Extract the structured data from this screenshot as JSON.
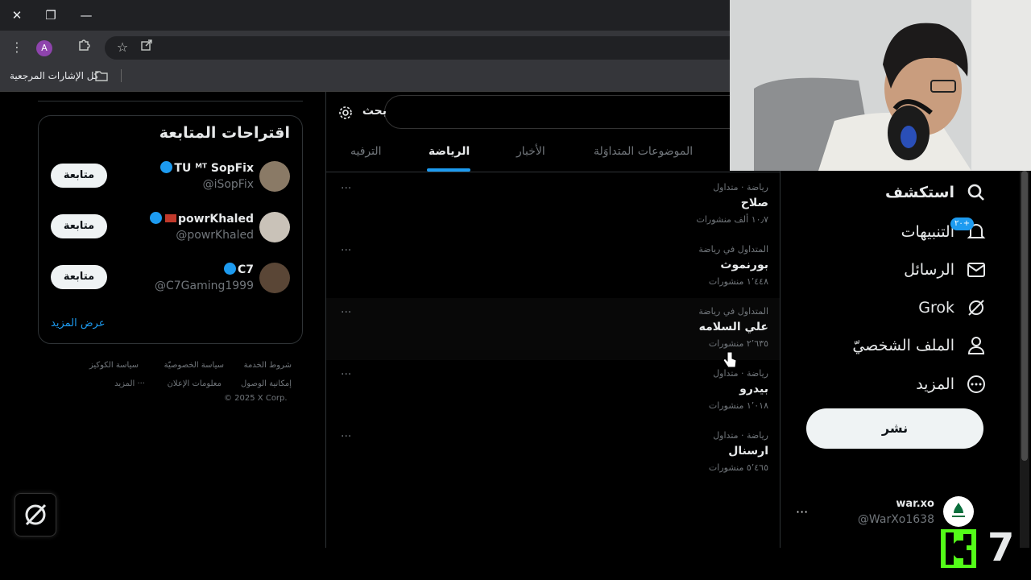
{
  "browser": {
    "avatar_letter": "A",
    "bookmarks_label": "كل الإشارات المرجعية"
  },
  "search": {
    "placeholder": "بحث"
  },
  "tabs": [
    {
      "label": "الترفيه"
    },
    {
      "label": "الرياضة"
    },
    {
      "label": "الأخبار"
    },
    {
      "label": "الموضوعات المتداوَلة"
    }
  ],
  "trends": [
    {
      "context": "رياضة · متداول",
      "name": "صلاح",
      "count": "١٠٫٧ ألف منشورات"
    },
    {
      "context": "المتداول في رياضة",
      "name": "بورنموث",
      "count": "١٬٤٤٨ منشورات"
    },
    {
      "context": "المتداول في رياضة",
      "name": "علي السلامه",
      "count": "٢٬٦٣٥ منشورات"
    },
    {
      "context": "رياضة · متداول",
      "name": "بيدرو",
      "count": "١٬٠١٨ منشورات"
    },
    {
      "context": "رياضة · متداول",
      "name": "ارسنال",
      "count": "٥٬٤٦٥ منشورات"
    }
  ],
  "trend_more": "···",
  "nav": {
    "explore": "استكشف",
    "notifications": "التنبيهات",
    "notifications_badge": "٢٠+",
    "messages": "الرسائل",
    "grok": "Grok",
    "profile": "الملف الشخصيّ",
    "more": "المزيد",
    "post": "نشر"
  },
  "account": {
    "name": "war.xo",
    "handle": "@WarXo1638",
    "more": "···"
  },
  "suggestions": {
    "title": "اقتراحات المتابعة",
    "follow_label": "متابعة",
    "show_more": "عرض المزيد",
    "users": [
      {
        "name": "TU ᴹᵀ SopFix",
        "handle": "@iSopFix"
      },
      {
        "name": "powrKhaled",
        "handle": "@powrKhaled"
      },
      {
        "name": "C7",
        "handle": "@C7Gaming1999"
      }
    ]
  },
  "footer": {
    "terms": "شروط الخدمة",
    "privacy": "سياسة الخصوصيّة",
    "cookies": "سياسة الكوكيز",
    "accessibility": "إمكانية الوصول",
    "ads": "معلومات الإعلان",
    "more": "··· المزيد",
    "copyright": "© 2025 X Corp."
  },
  "overlay": {
    "logo_digit": "7"
  }
}
